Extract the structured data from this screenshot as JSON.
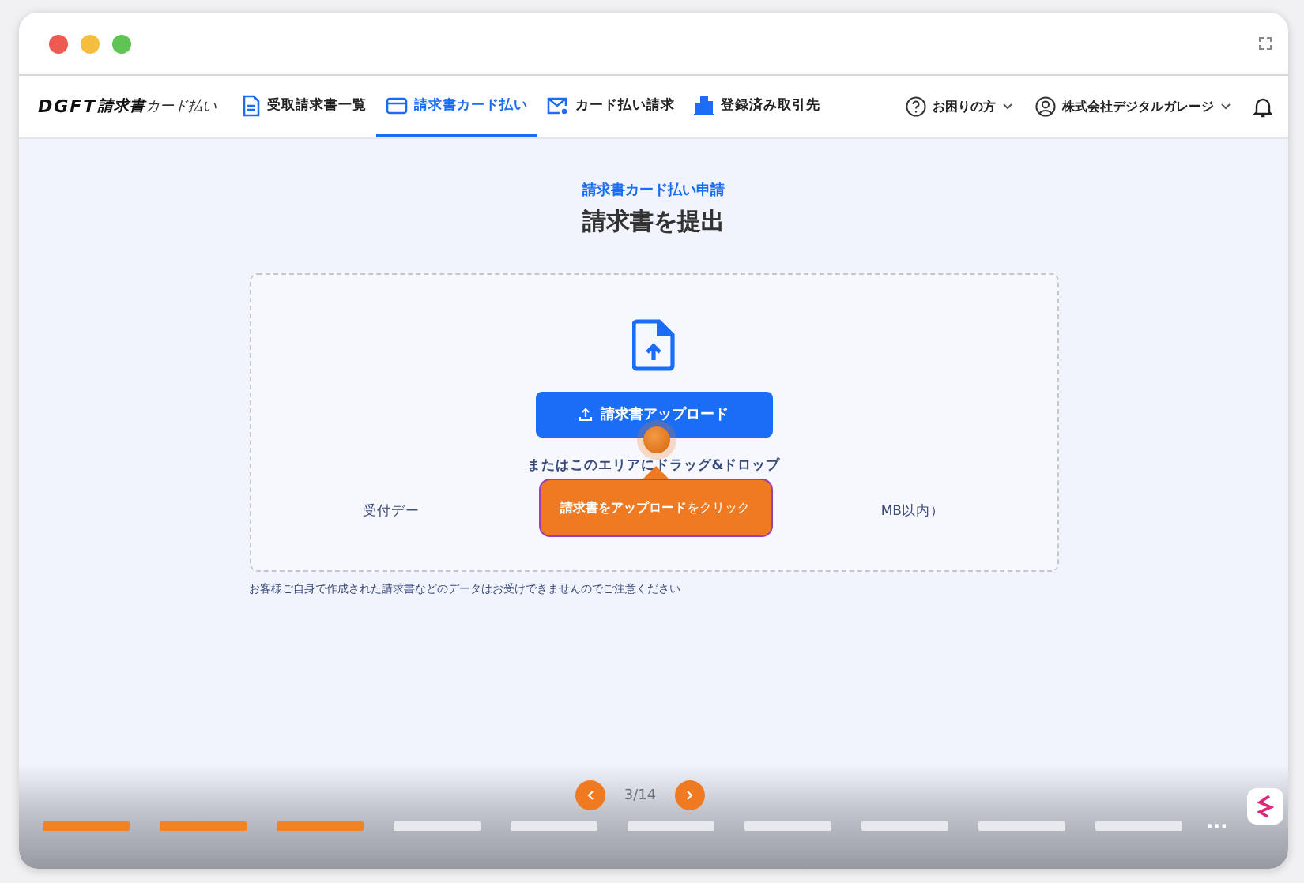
{
  "nav": {
    "logo": {
      "brand": "DGFT",
      "product": "請求書",
      "suffix": "カード払い"
    },
    "tabs": [
      {
        "label": "受取請求書一覧",
        "kind": "document",
        "selected": false
      },
      {
        "label": "請求書カード払い",
        "kind": "card",
        "selected": true
      },
      {
        "label": "カード払い請求",
        "kind": "mail",
        "selected": false
      },
      {
        "label": "登録済み取引先",
        "kind": "building",
        "selected": false
      }
    ],
    "help": "お困りの方",
    "account": "株式会社デジタルガレージ"
  },
  "page": {
    "eyebrow": "請求書カード払い申請",
    "title": "請求書を提出",
    "upload_button": "請求書アップロード",
    "drop_hint": "またはこのエリアにドラッグ&ドロップ",
    "accepted_start": "受付デー",
    "accepted_end": "MB以内）",
    "note": "お客様ご自身で作成された請求書などのデータはお受けできませんのでご注意ください"
  },
  "tooltip": {
    "text": "**請求書をアップロード** をクリック"
  },
  "tour": {
    "counter": "3/14",
    "more": "···",
    "steps": [
      {
        "completed": true
      },
      {
        "completed": true
      },
      {
        "completed": true
      },
      {
        "completed": false
      },
      {
        "completed": false
      },
      {
        "completed": false
      },
      {
        "completed": false
      },
      {
        "completed": false
      },
      {
        "completed": false
      },
      {
        "completed": false
      }
    ]
  }
}
